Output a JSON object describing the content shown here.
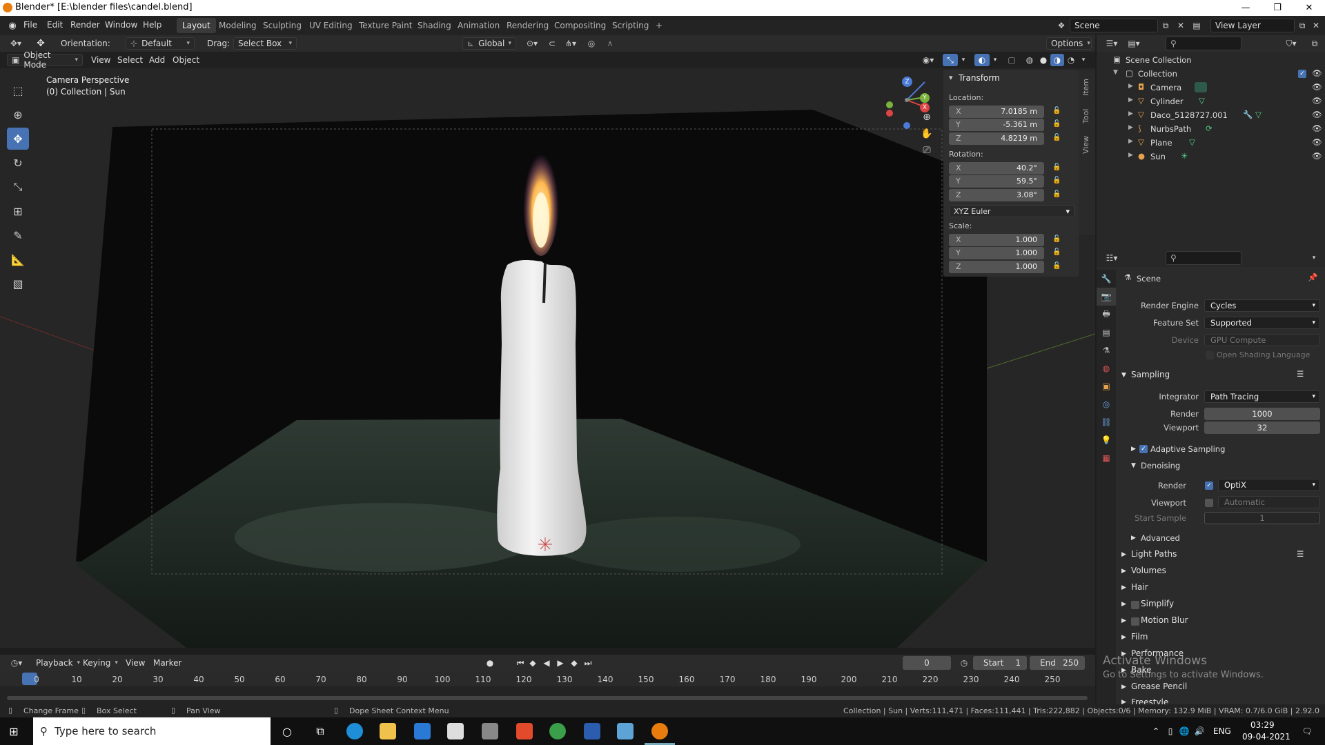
{
  "titlebar": {
    "title": "Blender* [E:\\blender files\\candel.blend]"
  },
  "menu": {
    "file": "File",
    "edit": "Edit",
    "render": "Render",
    "window": "Window",
    "help": "Help"
  },
  "workspaces": [
    "Layout",
    "Modeling",
    "Sculpting",
    "UV Editing",
    "Texture Paint",
    "Shading",
    "Animation",
    "Rendering",
    "Compositing",
    "Scripting"
  ],
  "scene": {
    "name": "Scene",
    "view_layer": "View Layer"
  },
  "header": {
    "orientation_label": "Orientation:",
    "orientation_value": "Default",
    "drag_label": "Drag:",
    "drag_value": "Select Box",
    "transform_space": "Global",
    "options": "Options"
  },
  "viewport_header": {
    "mode": "Object Mode",
    "view": "View",
    "select": "Select",
    "add": "Add",
    "object": "Object"
  },
  "viewport": {
    "camera_label": "Camera Perspective",
    "collection_label": "(0) Collection | Sun"
  },
  "transform": {
    "title": "Transform",
    "location_label": "Location:",
    "location": {
      "x": "7.0185 m",
      "y": "-5.361 m",
      "z": "4.8219 m"
    },
    "rotation_label": "Rotation:",
    "rotation": {
      "x": "40.2°",
      "y": "59.5°",
      "z": "3.08°"
    },
    "rotation_mode": "XYZ Euler",
    "scale_label": "Scale:",
    "scale": {
      "x": "1.000",
      "y": "1.000",
      "z": "1.000"
    },
    "axis_x": "X",
    "axis_y": "Y",
    "axis_z": "Z"
  },
  "side_tabs": [
    "Item",
    "Tool",
    "View"
  ],
  "outliner": {
    "root": "Scene Collection",
    "collection": "Collection",
    "items": [
      "Camera",
      "Cylinder",
      "Daco_5128727.001",
      "NurbsPath",
      "Plane",
      "Sun"
    ]
  },
  "properties": {
    "scene": "Scene",
    "render_engine_label": "Render Engine",
    "render_engine": "Cycles",
    "feature_set_label": "Feature Set",
    "feature_set": "Supported",
    "device_label": "Device",
    "device": "GPU Compute",
    "osl": "Open Shading Language",
    "sampling": "Sampling",
    "integrator_label": "Integrator",
    "integrator": "Path Tracing",
    "render_label": "Render",
    "render_samples": "1000",
    "viewport_label": "Viewport",
    "viewport_samples": "32",
    "adaptive": "Adaptive Sampling",
    "denoising": "Denoising",
    "den_render": "OptiX",
    "den_viewport": "Automatic",
    "start_sample_label": "Start Sample",
    "start_sample": "1",
    "advanced": "Advanced",
    "sections": [
      "Light Paths",
      "Volumes",
      "Hair",
      "Simplify",
      "Motion Blur",
      "Film",
      "Performance",
      "Bake",
      "Grease Pencil",
      "Freestyle"
    ]
  },
  "timeline": {
    "playback": "Playback",
    "keying": "Keying",
    "view": "View",
    "marker": "Marker",
    "current": "0",
    "start_label": "Start",
    "start": "1",
    "end_label": "End",
    "end": "250",
    "ticks": [
      "0",
      "10",
      "20",
      "30",
      "40",
      "50",
      "60",
      "70",
      "80",
      "90",
      "100",
      "110",
      "120",
      "130",
      "140",
      "150",
      "160",
      "170",
      "180",
      "190",
      "200",
      "210",
      "220",
      "230",
      "240",
      "250"
    ]
  },
  "status": {
    "change_frame": "Change Frame",
    "box_select": "Box Select",
    "pan_view": "Pan View",
    "context": "Dope Sheet Context Menu",
    "stats": "Collection | Sun | Verts:111,471 | Faces:111,441 | Tris:222,882 | Objects:0/6 | Memory: 132.9 MiB | VRAM: 0.7/6.0 GiB | 2.92.0"
  },
  "watermark": {
    "line1": "Activate Windows",
    "line2": "Go to Settings to activate Windows."
  },
  "taskbar": {
    "search": "Type here to search",
    "lang": "ENG",
    "time": "03:29",
    "date": "09-04-2021"
  }
}
